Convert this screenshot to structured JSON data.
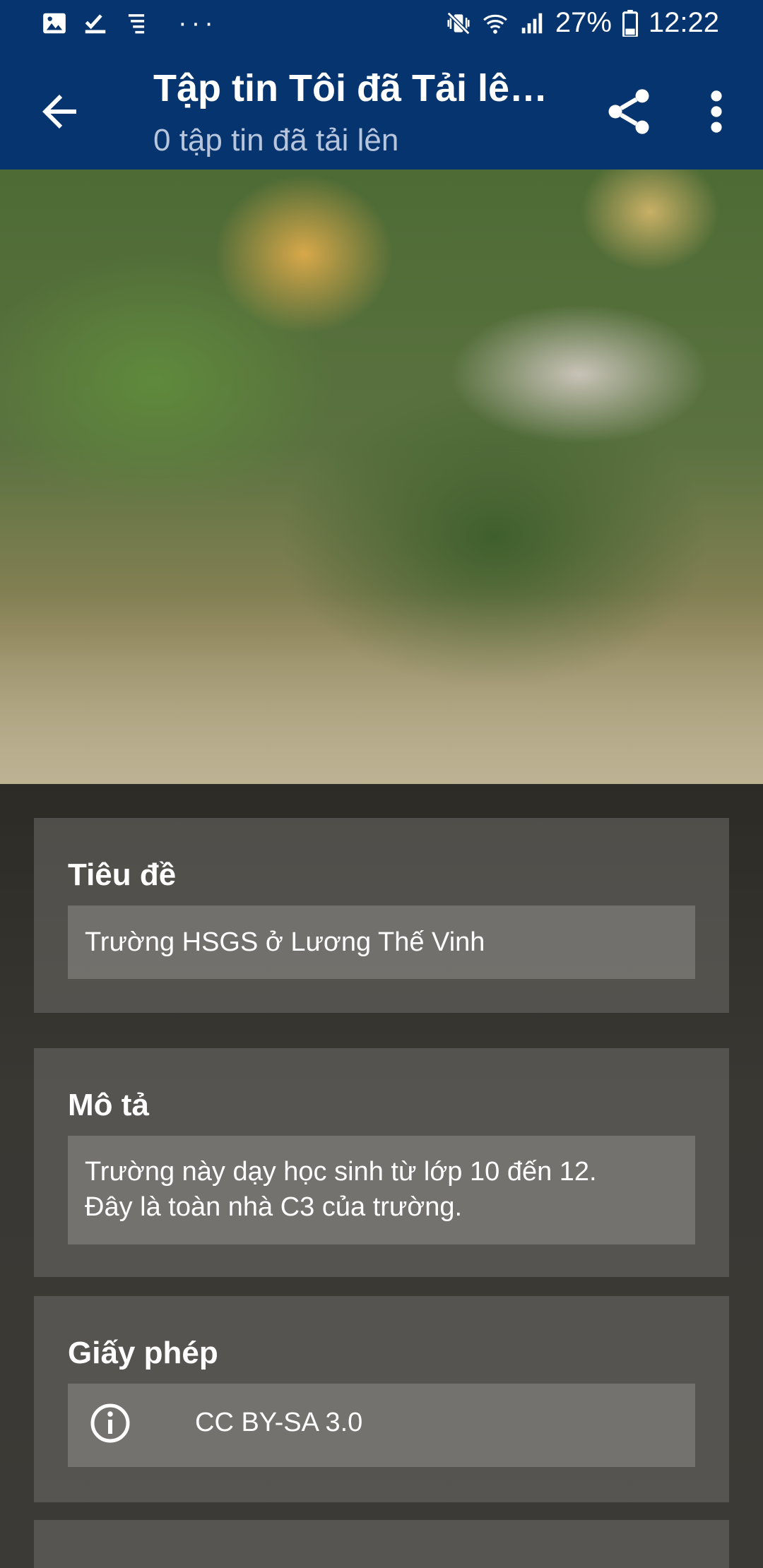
{
  "status_bar": {
    "battery": "27%",
    "time": "12:22",
    "overflow": "···"
  },
  "app_bar": {
    "title": "Tập tin Tôi đã Tải lê…",
    "subtitle": "0 tập tin đã tải lên"
  },
  "form": {
    "title_card": {
      "label": "Tiêu đề",
      "value": "Trường HSGS ở Lương Thế Vinh"
    },
    "description_card": {
      "label": "Mô tả",
      "line1": "Trường này dạy học sinh từ lớp 10 đến 12.",
      "line2": "Đây là toàn nhà C3 của trường."
    },
    "license_card": {
      "label": "Giấy phép",
      "value": "CC BY-SA 3.0"
    }
  },
  "icons": {
    "back": "back-arrow-icon",
    "share": "share-icon",
    "more": "more-vert-icon",
    "info": "info-icon"
  },
  "colors": {
    "app_bar": "#06346e",
    "card_bg": "#6e6c68"
  }
}
